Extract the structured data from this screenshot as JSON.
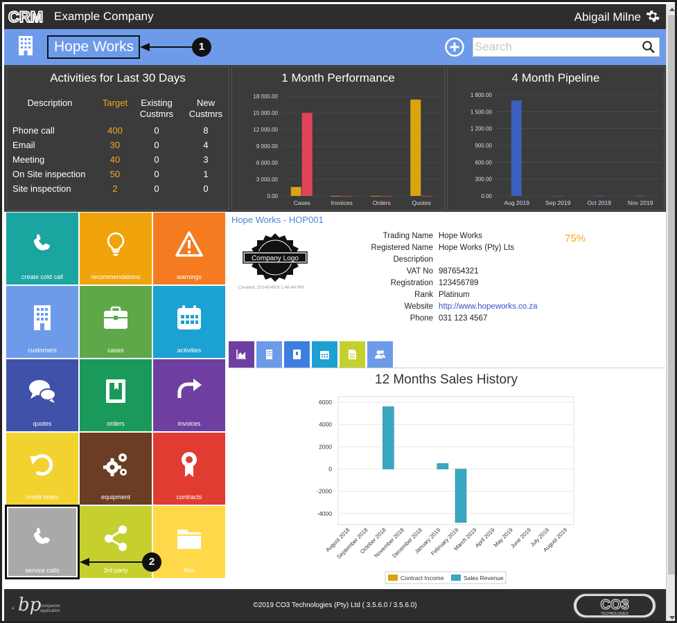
{
  "topbar": {
    "app_logo": "CRM",
    "company": "Example Company",
    "user": "Abigail Milne",
    "settings_icon": "gear-icon"
  },
  "header": {
    "client_title": "Hope Works",
    "search_placeholder": "Search",
    "add_icon": "plus-circle-icon",
    "search_icon": "search-icon"
  },
  "callouts": [
    "1",
    "2"
  ],
  "activities": {
    "title": "Activities for Last 30 Days",
    "headers": [
      "Description",
      "Target",
      "Existing Custmrs",
      "New Custmrs"
    ],
    "rows": [
      {
        "desc": "Phone call",
        "target": "400",
        "existing": "0",
        "new": "8"
      },
      {
        "desc": "Email",
        "target": "30",
        "existing": "0",
        "new": "4"
      },
      {
        "desc": "Meeting",
        "target": "40",
        "existing": "0",
        "new": "3"
      },
      {
        "desc": "On Site inspection",
        "target": "50",
        "existing": "0",
        "new": "1"
      },
      {
        "desc": "Site inspection",
        "target": "2",
        "existing": "0",
        "new": "0"
      }
    ]
  },
  "chart_data": [
    {
      "type": "bar",
      "title": "1 Month Performance",
      "categories": [
        "Cases",
        "Invoices",
        "Orders",
        "Quotes"
      ],
      "series": [
        {
          "values": [
            1600,
            0,
            0,
            17400
          ],
          "color": "#d9a50f"
        },
        {
          "values": [
            15000,
            0,
            0,
            0
          ],
          "color": "#e0445a"
        }
      ],
      "yticks": [
        "0.00",
        "3 000.00",
        "6 000.00",
        "9 000.00",
        "12 000.00",
        "15 000.00",
        "18 000.00"
      ],
      "ylim": [
        0,
        18000
      ]
    },
    {
      "type": "bar",
      "title": "4 Month Pipeline",
      "categories": [
        "Aug 2019",
        "Sep 2019",
        "Oct 2019",
        "Nov 2019"
      ],
      "series": [
        {
          "values": [
            1700,
            0,
            0,
            0
          ],
          "color": "#3d5fbf"
        }
      ],
      "yticks": [
        "0.00",
        "300.00",
        "600.00",
        "900.00",
        "1 200.00",
        "1 500.00",
        "1 800.00"
      ],
      "ylim": [
        0,
        1800
      ]
    },
    {
      "type": "bar",
      "title": "12 Months Sales History",
      "categories": [
        "August 2018",
        "September 2018",
        "October 2018",
        "November 2018",
        "December 2018",
        "January 2019",
        "February 2019",
        "March 2019",
        "April 2019",
        "May 2019",
        "June 2019",
        "July 2019",
        "August 2019"
      ],
      "series": [
        {
          "name": "Contract Income",
          "values": [
            0,
            0,
            0,
            0,
            0,
            0,
            0,
            0,
            0,
            0,
            0,
            0,
            0
          ],
          "color": "#d9a50f"
        },
        {
          "name": "Sales Revenue",
          "values": [
            0,
            0,
            5600,
            0,
            0,
            500,
            -4800,
            0,
            0,
            0,
            0,
            0,
            0
          ],
          "color": "#3aa7c0"
        }
      ],
      "yticks": [
        "-4000",
        "-2000",
        "0",
        "2000",
        "4000",
        "6000"
      ],
      "ylim": [
        -5000,
        6500
      ],
      "legend": "bottom"
    }
  ],
  "tiles": [
    {
      "label": "create cold call",
      "icon": "phone-icon",
      "color": "#1aa5a0"
    },
    {
      "label": "recommendations",
      "icon": "lightbulb-icon",
      "color": "#f0a30a"
    },
    {
      "label": "warnings",
      "icon": "warning-icon",
      "color": "#f47b20"
    },
    {
      "label": "customers",
      "icon": "building-icon",
      "color": "#6d9bea"
    },
    {
      "label": "cases",
      "icon": "briefcase-icon",
      "color": "#5ea84a"
    },
    {
      "label": "activities",
      "icon": "calendar-icon",
      "color": "#1ba1d2"
    },
    {
      "label": "quotes",
      "icon": "chat-icon",
      "color": "#3f51a8"
    },
    {
      "label": "orders",
      "icon": "book-icon",
      "color": "#1a9a5a"
    },
    {
      "label": "invoices",
      "icon": "redo-arrow-icon",
      "color": "#6e3fa0"
    },
    {
      "label": "credit notes",
      "icon": "undo-arrow-icon",
      "color": "#f2d22e"
    },
    {
      "label": "equipment",
      "icon": "cogs-icon",
      "color": "#6b3d24"
    },
    {
      "label": "contracts",
      "icon": "award-icon",
      "color": "#e03c31"
    },
    {
      "label": "service calls",
      "icon": "phone-icon",
      "color": "#a9a9a9"
    },
    {
      "label": "3rd party",
      "icon": "share-icon",
      "color": "#c5d02e"
    },
    {
      "label": "files",
      "icon": "folder-icon",
      "color": "#ffd94a"
    }
  ],
  "client": {
    "code": "Hope Works - HOP001",
    "logo_text": "Company Logo",
    "created": "Created: 2014/04/03 1:46:44 PM",
    "percent": "75%",
    "fields": [
      {
        "label": "Trading Name",
        "value": "Hope Works"
      },
      {
        "label": "Registered Name",
        "value": "Hope Works (Pty) Lts"
      },
      {
        "label": "Description",
        "value": ""
      },
      {
        "label": "VAT No",
        "value": "987654321"
      },
      {
        "label": "Registration",
        "value": "123456789"
      },
      {
        "label": "Rank",
        "value": "Platinum"
      },
      {
        "label": "Website",
        "value": "http://www.hopeworks.co.za"
      },
      {
        "label": "Phone",
        "value": "031 123 4567"
      }
    ]
  },
  "subtabs": [
    {
      "icon": "area-chart-icon",
      "color": "#6e3fa0"
    },
    {
      "icon": "building-icon",
      "color": "#6d9bea"
    },
    {
      "icon": "address-book-icon",
      "color": "#3d7fe0"
    },
    {
      "icon": "calendar-icon",
      "color": "#1ba1d2"
    },
    {
      "icon": "document-icon",
      "color": "#c5d02e"
    },
    {
      "icon": "users-icon",
      "color": "#6d9bea"
    }
  ],
  "footer": {
    "copyright": "©2019 CO3 Technologies (Pty) Ltd ( 3.5.6.0 / 3.5.6.0)",
    "bp_letters": "bp",
    "bp_small_a": "a",
    "bp_line1": "companion",
    "bp_line2": "application",
    "co3_text": "CO3",
    "co3_sub": "TECHNOLOGIES"
  }
}
